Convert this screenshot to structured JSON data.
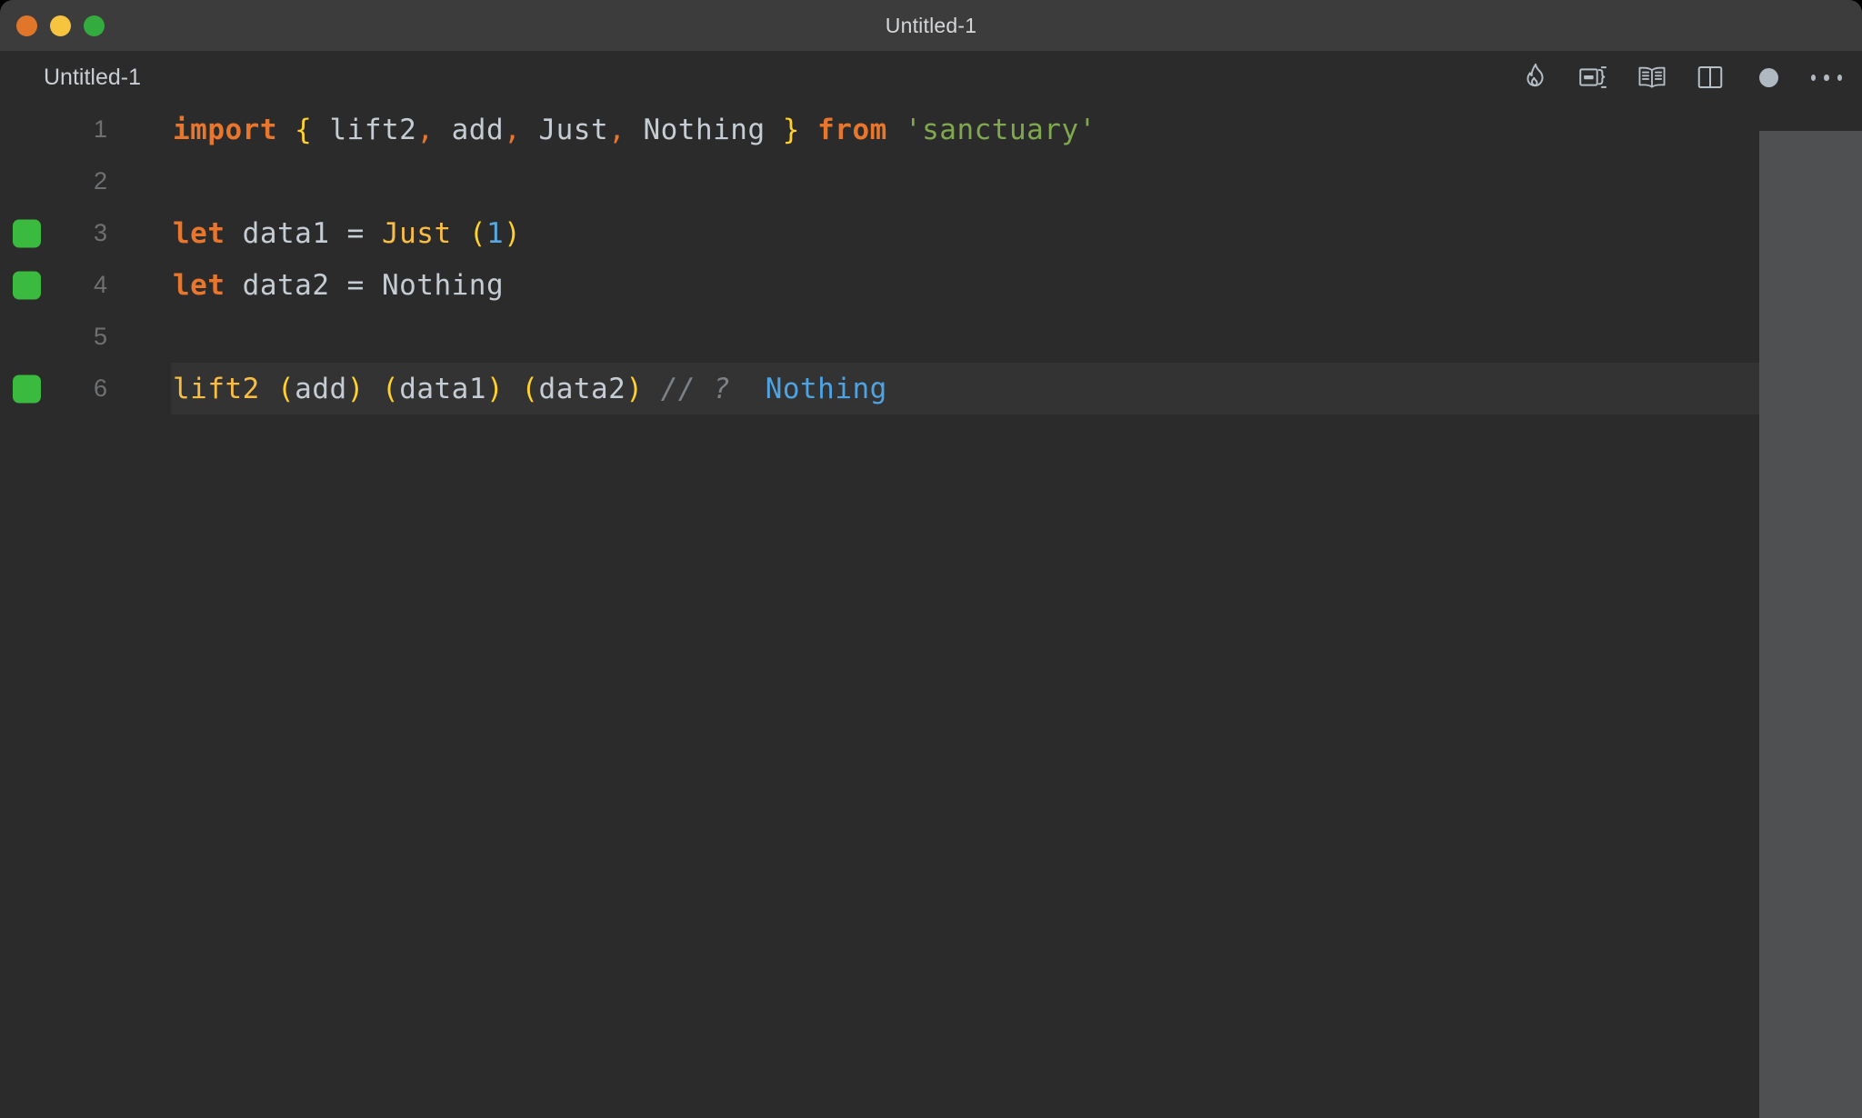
{
  "window": {
    "title": "Untitled-1",
    "traffic_lights": [
      {
        "name": "close",
        "color": "#e0762a"
      },
      {
        "name": "minimize",
        "color": "#f7c43f"
      },
      {
        "name": "maximize",
        "color": "#33ab3f"
      }
    ]
  },
  "tab": {
    "label": "Untitled-1"
  },
  "toolbar": {
    "icons": [
      {
        "name": "flame-icon",
        "title": "Run live / Quokka"
      },
      {
        "name": "run-editor-icon",
        "title": "Run and debug"
      },
      {
        "name": "open-book-icon",
        "title": "Open preview"
      },
      {
        "name": "split-editor-icon",
        "title": "Split editor right"
      },
      {
        "name": "unsaved-dot-icon",
        "title": "Unsaved changes"
      },
      {
        "name": "more-actions-icon",
        "title": "More actions"
      }
    ]
  },
  "editor": {
    "language": "javascript",
    "active_line": 6,
    "gutter_marked_lines": [
      3,
      4,
      6
    ],
    "lines": [
      {
        "number": "1",
        "marked": false,
        "active": false,
        "tokens": [
          {
            "text": "import",
            "cls": "t-kw"
          },
          {
            "text": " ",
            "cls": "t-plain"
          },
          {
            "text": "{",
            "cls": "t-brace"
          },
          {
            "text": " lift2",
            "cls": "t-plain"
          },
          {
            "text": ",",
            "cls": "t-punct"
          },
          {
            "text": " add",
            "cls": "t-plain"
          },
          {
            "text": ",",
            "cls": "t-punct"
          },
          {
            "text": " Just",
            "cls": "t-plain"
          },
          {
            "text": ",",
            "cls": "t-punct"
          },
          {
            "text": " Nothing ",
            "cls": "t-plain"
          },
          {
            "text": "}",
            "cls": "t-brace"
          },
          {
            "text": " ",
            "cls": "t-plain"
          },
          {
            "text": "from",
            "cls": "t-kw"
          },
          {
            "text": " ",
            "cls": "t-plain"
          },
          {
            "text": "'sanctuary'",
            "cls": "t-string"
          }
        ]
      },
      {
        "number": "2",
        "marked": false,
        "active": false,
        "tokens": []
      },
      {
        "number": "3",
        "marked": true,
        "active": false,
        "tokens": [
          {
            "text": "let",
            "cls": "t-kw"
          },
          {
            "text": " data1 = ",
            "cls": "t-plain"
          },
          {
            "text": "Just",
            "cls": "t-func"
          },
          {
            "text": " ",
            "cls": "t-plain"
          },
          {
            "text": "(",
            "cls": "t-paren"
          },
          {
            "text": "1",
            "cls": "t-num"
          },
          {
            "text": ")",
            "cls": "t-paren"
          }
        ]
      },
      {
        "number": "4",
        "marked": true,
        "active": false,
        "tokens": [
          {
            "text": "let",
            "cls": "t-kw"
          },
          {
            "text": " data2 = Nothing",
            "cls": "t-plain"
          }
        ]
      },
      {
        "number": "5",
        "marked": false,
        "active": false,
        "tokens": []
      },
      {
        "number": "6",
        "marked": true,
        "active": true,
        "tokens": [
          {
            "text": "lift2",
            "cls": "t-func"
          },
          {
            "text": " ",
            "cls": "t-plain"
          },
          {
            "text": "(",
            "cls": "t-paren"
          },
          {
            "text": "add",
            "cls": "t-plain"
          },
          {
            "text": ")",
            "cls": "t-paren"
          },
          {
            "text": " ",
            "cls": "t-plain"
          },
          {
            "text": "(",
            "cls": "t-paren"
          },
          {
            "text": "data1",
            "cls": "t-plain"
          },
          {
            "text": ")",
            "cls": "t-paren"
          },
          {
            "text": " ",
            "cls": "t-plain"
          },
          {
            "text": "(",
            "cls": "t-paren"
          },
          {
            "text": "data2",
            "cls": "t-plain"
          },
          {
            "text": ")",
            "cls": "t-paren"
          },
          {
            "text": " ",
            "cls": "t-plain"
          },
          {
            "text": "// ?",
            "cls": "t-comment"
          },
          {
            "text": "  ",
            "cls": "t-plain"
          },
          {
            "text": "Nothing",
            "cls": "t-result"
          }
        ]
      }
    ]
  },
  "colors": {
    "titlebar_bg": "#3c3c3c",
    "editor_bg": "#2b2b2b",
    "active_line_bg": "#333333",
    "gutter_marker": "#3aba3f",
    "scrollbar": "#4e5052",
    "keyword": "#e8762c",
    "string": "#7fa84f",
    "function": "#f9bd45",
    "paren": "#ffd02e",
    "number": "#5aa8e0",
    "comment": "#7d8287",
    "result": "#4fa3e3",
    "text": "#c6ccd4"
  }
}
